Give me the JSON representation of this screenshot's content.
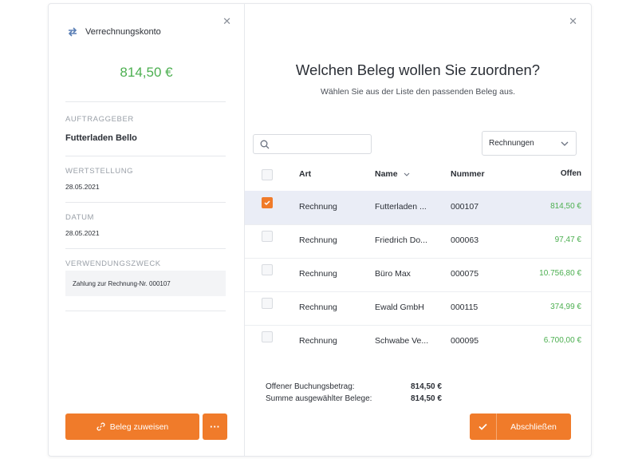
{
  "colors": {
    "accent": "#f07b2a",
    "positive": "#4caf50",
    "selected_row": "#eaedf6"
  },
  "left_panel": {
    "account_icon": "swap-arrows-icon",
    "account_label": "Verrechnungskonto",
    "amount": "814,50 €",
    "fields": {
      "auftraggeber_label": "AUFTRAGGEBER",
      "auftraggeber_value": "Futterladen Bello",
      "wertstellung_label": "WERTSTELLUNG",
      "wertstellung_value": "28.05.2021",
      "datum_label": "DATUM",
      "datum_value": "28.05.2021",
      "zweck_label": "VERWENDUNGSZWECK",
      "zweck_value": "Zahlung zur Rechnung-Nr. 000107"
    },
    "assign_button": "Beleg zuweisen",
    "more_button": "···"
  },
  "right_panel": {
    "title": "Welchen Beleg wollen Sie zuordnen?",
    "subtitle": "Wählen Sie aus der Liste den passenden Beleg aus.",
    "search_placeholder": "",
    "filter_selected": "Rechnungen",
    "columns": {
      "art": "Art",
      "name": "Name",
      "nummer": "Nummer",
      "offen": "Offen"
    },
    "rows": [
      {
        "art": "Rechnung",
        "name": "Futterladen ...",
        "nummer": "000107",
        "offen": "814,50 €",
        "checked": true
      },
      {
        "art": "Rechnung",
        "name": "Friedrich Do...",
        "nummer": "000063",
        "offen": "97,47 €",
        "checked": false
      },
      {
        "art": "Rechnung",
        "name": "Büro Max",
        "nummer": "000075",
        "offen": "10.756,80 €",
        "checked": false
      },
      {
        "art": "Rechnung",
        "name": "Ewald GmbH",
        "nummer": "000115",
        "offen": "374,99 €",
        "checked": false
      },
      {
        "art": "Rechnung",
        "name": "Schwabe Ve...",
        "nummer": "000095",
        "offen": "6.700,00 €",
        "checked": false
      }
    ],
    "summary": {
      "open_label": "Offener Buchungsbetrag:",
      "open_value": "814,50 €",
      "selected_label": "Summe ausgewählter Belege:",
      "selected_value": "814,50 €"
    },
    "finish_button": "Abschließen"
  }
}
